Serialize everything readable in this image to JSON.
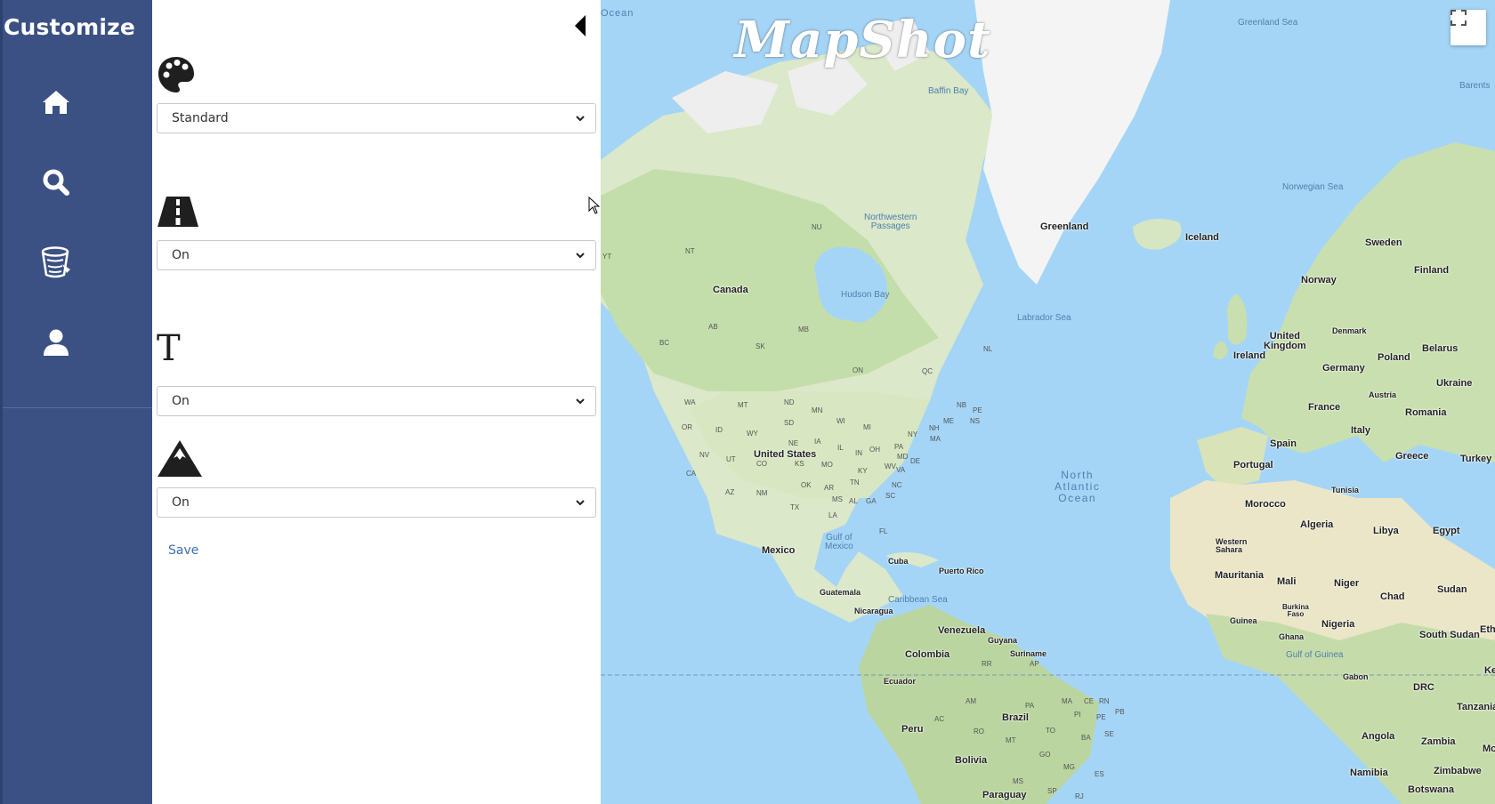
{
  "sidebar": {
    "title": "Customize",
    "items": [
      {
        "name": "home-icon"
      },
      {
        "name": "search-icon"
      },
      {
        "name": "bucket-icon"
      },
      {
        "name": "user-icon"
      }
    ]
  },
  "panel": {
    "style_select": {
      "value": "Standard",
      "icon": "palette-icon"
    },
    "roads_select": {
      "value": "On",
      "icon": "road-icon"
    },
    "labels_select": {
      "value": "On",
      "icon": "text-icon",
      "glyph": "T"
    },
    "terrain_select": {
      "value": "On",
      "icon": "mountain-icon"
    },
    "save_label": "Save"
  },
  "map": {
    "logo": "MapShot",
    "fullscreen_icon": "fullscreen-icon",
    "labels": {
      "canada": "Canada",
      "united_states": "United States",
      "mexico": "Mexico",
      "greenland": "Greenland",
      "iceland": "Iceland",
      "norway": "Norway",
      "sweden": "Sweden",
      "finland": "Finland",
      "united_kingdom": "United\nKingdom",
      "ireland": "Ireland",
      "denmark": "Denmark",
      "germany": "Germany",
      "poland": "Poland",
      "belarus": "Belarus",
      "ukraine": "Ukraine",
      "austria": "Austria",
      "france": "France",
      "romania": "Romania",
      "italy": "Italy",
      "spain": "Spain",
      "portugal": "Portugal",
      "greece": "Greece",
      "turkey": "Turkey",
      "tunisia": "Tunisia",
      "morocco": "Morocco",
      "algeria": "Algeria",
      "libya": "Libya",
      "egypt": "Egypt",
      "western_sahara": "Western\nSahara",
      "mauritania": "Mauritania",
      "mali": "Mali",
      "niger": "Niger",
      "chad": "Chad",
      "sudan": "Sudan",
      "burkina_faso": "Burkina\nFaso",
      "guinea": "Guinea",
      "ghana": "Ghana",
      "nigeria": "Nigeria",
      "south_sudan": "South Sudan",
      "gabon": "Gabon",
      "drc": "DRC",
      "tanzania": "Tanzania",
      "angola": "Angola",
      "zambia": "Zambia",
      "namibia": "Namibia",
      "zimbabwe": "Zimbabwe",
      "botswana": "Botswana",
      "kenya": "Keny",
      "ethiopia": "Eth",
      "mozambique": "Moza",
      "cuba": "Cuba",
      "puerto_rico": "Puerto Rico",
      "guatemala": "Guatemala",
      "nicaragua": "Nicaragua",
      "venezuela": "Venezuela",
      "colombia": "Colombia",
      "guyana": "Guyana",
      "suriname": "Suriname",
      "ecuador": "Ecuador",
      "peru": "Peru",
      "brazil": "Brazil",
      "bolivia": "Bolivia",
      "paraguay": "Paraguay",
      "baffin_bay": "Baffin Bay",
      "greenland_sea": "Greenland Sea",
      "norwegian_sea": "Norwegian Sea",
      "labrador_sea": "Labrador Sea",
      "hudson_bay": "Hudson Bay",
      "northwestern_passages": "Northwestern\nPassages",
      "gulf_of_mexico": "Gulf of\nMexico",
      "caribbean_sea": "Caribbean Sea",
      "gulf_of_guinea": "Gulf of Guinea",
      "north_atlantic_ocean": "North\nAtlantic\nOcean",
      "barents": "Barents",
      "ocean_top": "Ocean",
      "nu": "NU",
      "nt": "NT",
      "yt": "YT",
      "bc": "BC",
      "ab": "AB",
      "sk": "SK",
      "mb": "MB",
      "on": "ON",
      "qc": "QC",
      "nl": "NL",
      "nb": "NB",
      "ns": "NS",
      "pe": "PE",
      "wa": "WA",
      "mt": "MT",
      "nd": "ND",
      "mn": "MN",
      "or": "OR",
      "id": "ID",
      "wy": "WY",
      "sd": "SD",
      "wi": "WI",
      "mi": "MI",
      "ny": "NY",
      "me": "ME",
      "nh": "NH",
      "ma": "MA",
      "ia": "IA",
      "ne": "NE",
      "nv": "NV",
      "ut": "UT",
      "co": "CO",
      "ks": "KS",
      "mo": "MO",
      "il": "IL",
      "in": "IN",
      "oh": "OH",
      "pa": "PA",
      "md": "MD",
      "de": "DE",
      "wv": "WV",
      "va": "VA",
      "ky": "KY",
      "ca": "CA",
      "az": "AZ",
      "nm": "NM",
      "ok": "OK",
      "ar": "AR",
      "tn": "TN",
      "nc": "NC",
      "sc": "SC",
      "ms": "MS",
      "al": "AL",
      "ga": "GA",
      "tx": "TX",
      "la": "LA",
      "fl": "FL",
      "am": "AM",
      "pa_br": "PA",
      "ma_br": "MA",
      "ce": "CE",
      "rn": "RN",
      "pb": "PB",
      "pi": "PI",
      "pe_br": "PE",
      "to": "TO",
      "ba": "BA",
      "se": "SE",
      "ac": "AC",
      "ro": "RO",
      "mt_br": "MT",
      "go": "GO",
      "mg": "MG",
      "es": "ES",
      "ms_br": "MS",
      "sp": "SP",
      "rj": "RJ",
      "rr": "RR",
      "ap": "AP"
    }
  }
}
